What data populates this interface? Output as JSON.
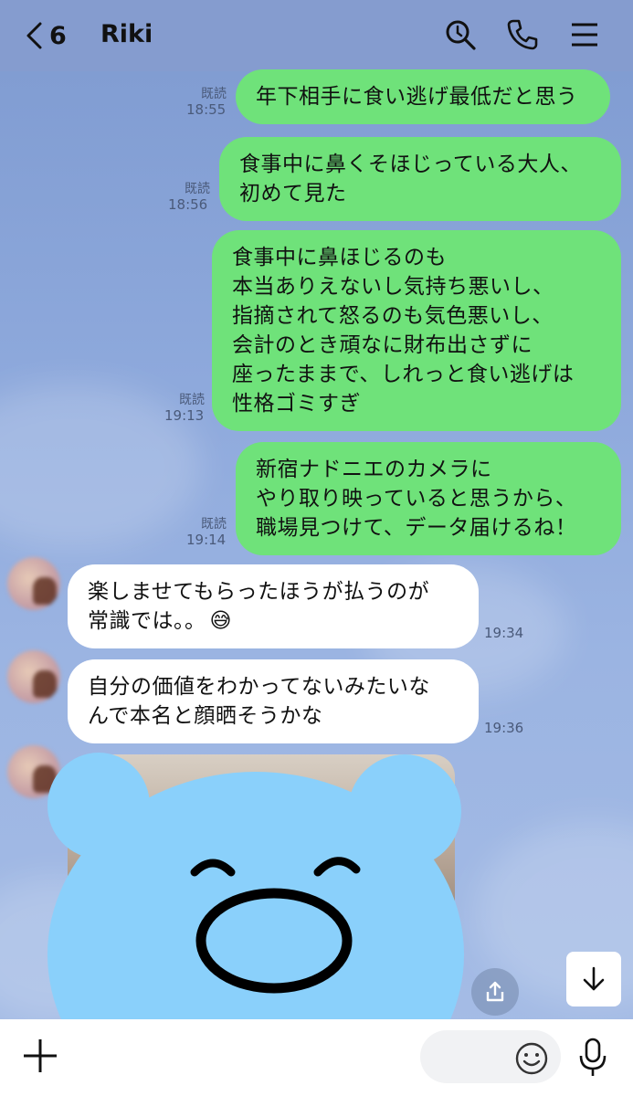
{
  "header": {
    "back_count": "6",
    "title": "Riki"
  },
  "messages": [
    {
      "side": "me",
      "read": "既読",
      "time": "18:55",
      "lines": [
        "年下相手に食い逃げ最低だと思う"
      ]
    },
    {
      "side": "me",
      "read": "既読",
      "time": "18:56",
      "lines": [
        "食事中に鼻くそほじっている大人、",
        "初めて見た"
      ]
    },
    {
      "side": "me",
      "read": "既読",
      "time": "19:13",
      "lines": [
        "食事中に鼻ほじるのも",
        "本当ありえないし気持ち悪いし、",
        "指摘されて怒るのも気色悪いし、",
        "会計のとき頑なに財布出さずに",
        "座ったままで、しれっと食い逃げは",
        "性格ゴミすぎ"
      ]
    },
    {
      "side": "me",
      "read": "既読",
      "time": "19:14",
      "lines": [
        "新宿ナドニエのカメラに",
        "やり取り映っていると思うから、",
        "職場見つけて、データ届けるね！"
      ]
    },
    {
      "side": "them",
      "time": "19:34",
      "lines": [
        "楽しませてもらったほうが払うのが",
        "常識では。。"
      ],
      "emoji": "😅"
    },
    {
      "side": "them",
      "time": "19:36",
      "lines": [
        "自分の価値をわかってないみたいな",
        "んで本名と顔晒そうかな"
      ]
    }
  ],
  "icons": {
    "back": "chevron-left-icon",
    "search": "search-icon",
    "call": "phone-icon",
    "menu": "menu-icon",
    "scroll": "arrow-down-icon",
    "share": "share-icon",
    "plus": "plus-icon",
    "emoji": "smiley-icon",
    "mic": "microphone-icon"
  },
  "colors": {
    "my_bubble": "#6fe27a",
    "their_bubble": "#ffffff",
    "background": "#8fa9d8",
    "sticker": "#8ad0fb"
  }
}
